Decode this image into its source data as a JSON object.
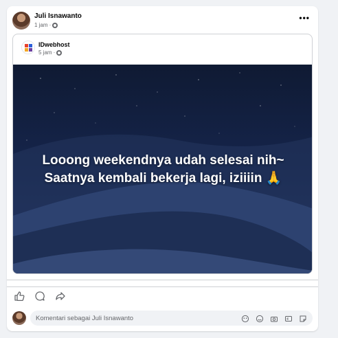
{
  "post": {
    "author_name": "Juli Isnawanto",
    "timestamp": "1 jam",
    "separator": "·",
    "more_label": "•••"
  },
  "shared": {
    "page_name": "IDwebhost",
    "timestamp": "5 jam",
    "separator": "·",
    "line1": "Looong weekendnya udah selesai nih~",
    "line2": "Saatnya kembali bekerja lagi, iziiiin 🙏"
  },
  "comment": {
    "placeholder": "Komentari sebagai Juli Isnawanto"
  },
  "icons": [
    "like-icon",
    "comment-icon",
    "share-icon",
    "avatar-sticker-icon",
    "emoji-icon",
    "camera-icon",
    "gif-icon",
    "sticker-icon",
    "globe-icon"
  ]
}
